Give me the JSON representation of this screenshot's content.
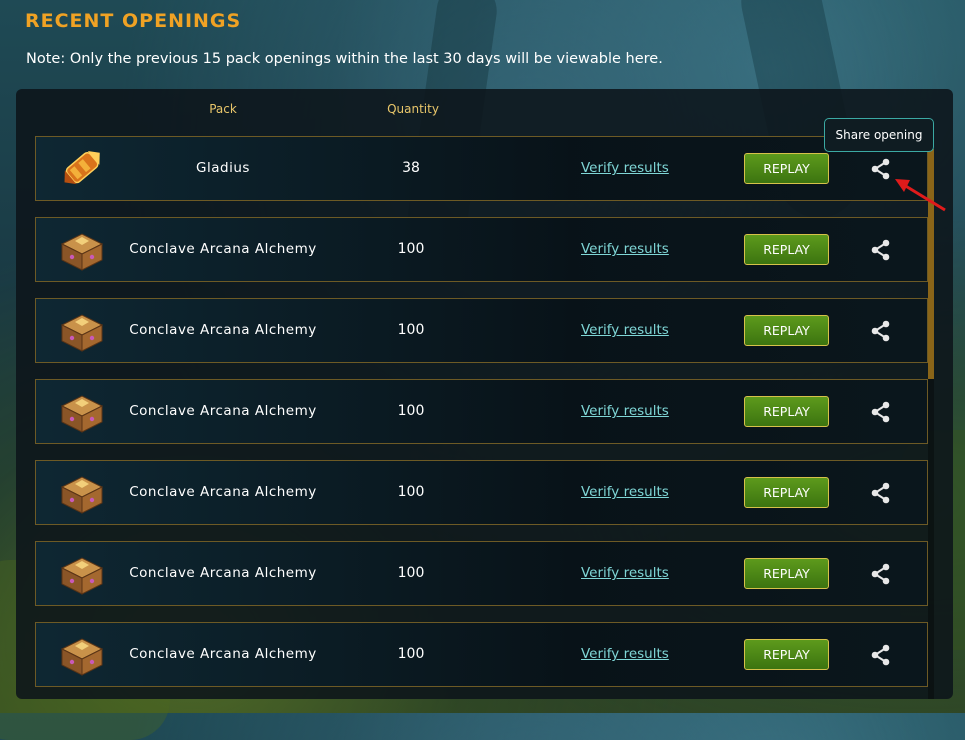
{
  "title": "RECENT OPENINGS",
  "note": "Note: Only the previous 15 pack openings within the last 30 days will be viewable here.",
  "columns": {
    "pack": "Pack",
    "quantity": "Quantity"
  },
  "tooltip": "Share opening",
  "colors": {
    "accent": "#f0a224",
    "link": "#7fd6d6",
    "button": "#4a8617",
    "row_border": "#6d5a25"
  },
  "rows": [
    {
      "icon": "gladius-pack-icon",
      "pack": "Gladius",
      "quantity": "38",
      "verify": "Verify results",
      "replay": "REPLAY",
      "share_icon": "share-icon"
    },
    {
      "icon": "conclave-chest-icon",
      "pack": "Conclave Arcana Alchemy",
      "quantity": "100",
      "verify": "Verify results",
      "replay": "REPLAY",
      "share_icon": "share-icon"
    },
    {
      "icon": "conclave-chest-icon",
      "pack": "Conclave Arcana Alchemy",
      "quantity": "100",
      "verify": "Verify results",
      "replay": "REPLAY",
      "share_icon": "share-icon"
    },
    {
      "icon": "conclave-chest-icon",
      "pack": "Conclave Arcana Alchemy",
      "quantity": "100",
      "verify": "Verify results",
      "replay": "REPLAY",
      "share_icon": "share-icon"
    },
    {
      "icon": "conclave-chest-icon",
      "pack": "Conclave Arcana Alchemy",
      "quantity": "100",
      "verify": "Verify results",
      "replay": "REPLAY",
      "share_icon": "share-icon"
    },
    {
      "icon": "conclave-chest-icon",
      "pack": "Conclave Arcana Alchemy",
      "quantity": "100",
      "verify": "Verify results",
      "replay": "REPLAY",
      "share_icon": "share-icon"
    },
    {
      "icon": "conclave-chest-icon",
      "pack": "Conclave Arcana Alchemy",
      "quantity": "100",
      "verify": "Verify results",
      "replay": "REPLAY",
      "share_icon": "share-icon"
    }
  ]
}
